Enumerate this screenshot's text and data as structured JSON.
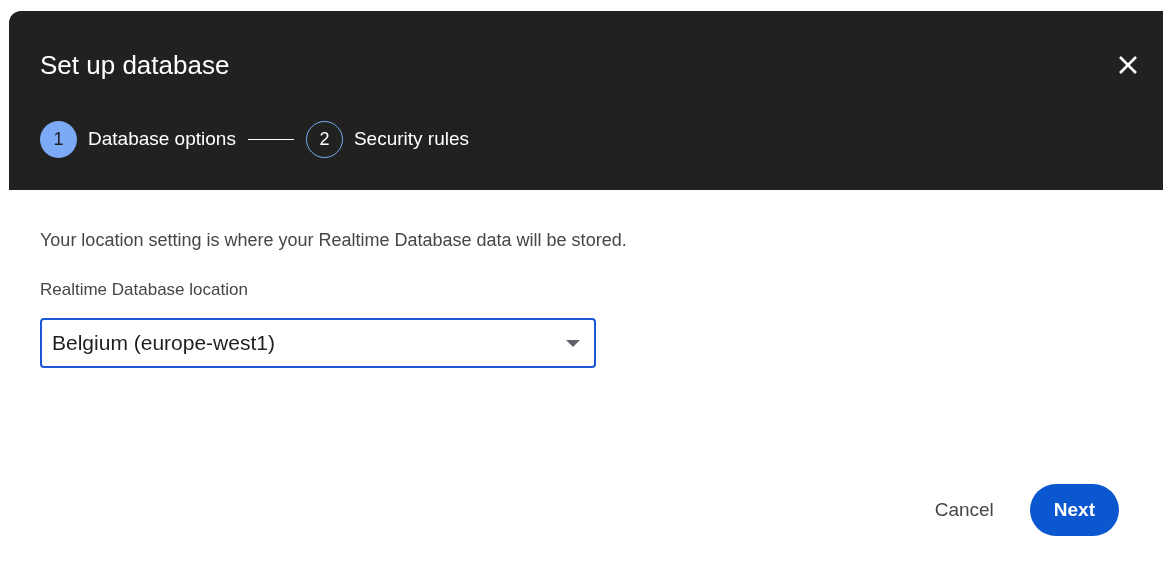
{
  "dialog": {
    "title": "Set up database",
    "steps": [
      {
        "number": "1",
        "label": "Database options",
        "selected": true
      },
      {
        "number": "2",
        "label": "Security rules",
        "selected": false
      }
    ],
    "description": "Your location setting is where your Realtime Database data will be stored.",
    "location_field": {
      "label": "Realtime Database location",
      "value": "Belgium (europe-west1)"
    },
    "buttons": [
      {
        "label": "Cancel",
        "kind": "text"
      },
      {
        "label": "Next",
        "kind": "primary"
      }
    ]
  }
}
